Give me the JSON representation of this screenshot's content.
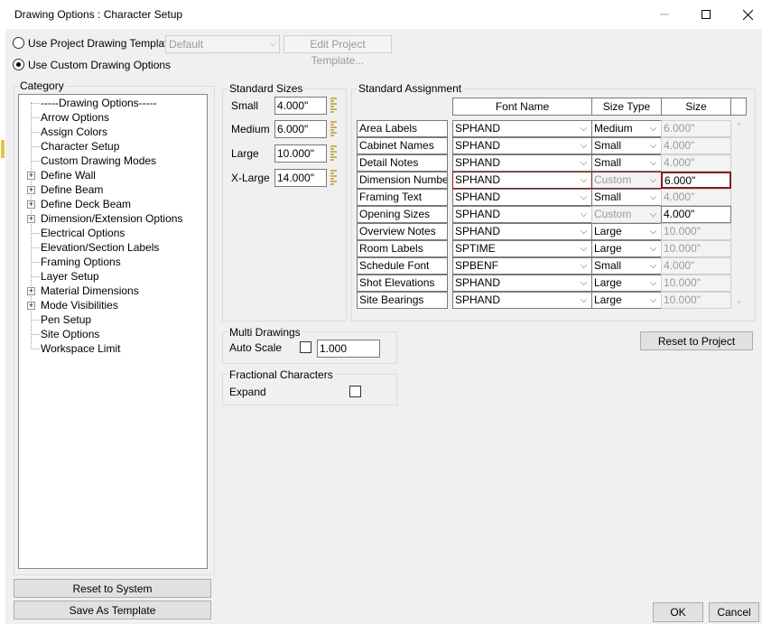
{
  "window": {
    "title": "Drawing Options : Character Setup"
  },
  "template_options": {
    "use_project": "Use Project Drawing Template",
    "use_custom": "Use Custom Drawing Options",
    "template_combo": "Default",
    "edit_template_btn": "Edit Project Template..."
  },
  "category": {
    "title": "Category",
    "items": [
      {
        "label": "-----Drawing Options-----",
        "expandable": false
      },
      {
        "label": "Arrow Options",
        "expandable": false
      },
      {
        "label": "Assign Colors",
        "expandable": false
      },
      {
        "label": "Character Setup",
        "expandable": false
      },
      {
        "label": "Custom Drawing Modes",
        "expandable": false
      },
      {
        "label": "Define Wall",
        "expandable": true
      },
      {
        "label": "Define Beam",
        "expandable": true
      },
      {
        "label": "Define Deck Beam",
        "expandable": true
      },
      {
        "label": "Dimension/Extension Options",
        "expandable": true
      },
      {
        "label": "Electrical Options",
        "expandable": false
      },
      {
        "label": "Elevation/Section Labels",
        "expandable": false
      },
      {
        "label": "Framing Options",
        "expandable": false
      },
      {
        "label": "Layer Setup",
        "expandable": false
      },
      {
        "label": "Material Dimensions",
        "expandable": true
      },
      {
        "label": "Mode Visibilities",
        "expandable": true
      },
      {
        "label": "Pen Setup",
        "expandable": false
      },
      {
        "label": "Site Options",
        "expandable": false
      },
      {
        "label": "Workspace Limit",
        "expandable": false
      }
    ]
  },
  "standard_sizes": {
    "title": "Standard Sizes",
    "rows": [
      {
        "label": "Small",
        "value": "4.000\""
      },
      {
        "label": "Medium",
        "value": "6.000\""
      },
      {
        "label": "Large",
        "value": "10.000\""
      },
      {
        "label": "X-Large",
        "value": "14.000\""
      }
    ]
  },
  "standard_assignment": {
    "title": "Standard Assignment",
    "headers": {
      "font": "Font Name",
      "size_type": "Size Type",
      "size": "Size"
    },
    "rows": [
      {
        "label": "Area Labels",
        "font": "SPHAND",
        "size_type": "Medium",
        "size": "6.000\"",
        "type_disabled": false,
        "size_enabled": false,
        "selected": false
      },
      {
        "label": "Cabinet Names",
        "font": "SPHAND",
        "size_type": "Small",
        "size": "4.000\"",
        "type_disabled": false,
        "size_enabled": false,
        "selected": false
      },
      {
        "label": "Detail Notes",
        "font": "SPHAND",
        "size_type": "Small",
        "size": "4.000\"",
        "type_disabled": false,
        "size_enabled": false,
        "selected": false
      },
      {
        "label": "Dimension Numbers",
        "font": "SPHAND",
        "size_type": "Custom",
        "size": "6.000\"",
        "type_disabled": true,
        "size_enabled": true,
        "selected": true
      },
      {
        "label": "Framing Text",
        "font": "SPHAND",
        "size_type": "Small",
        "size": "4.000\"",
        "type_disabled": false,
        "size_enabled": false,
        "selected": false
      },
      {
        "label": "Opening Sizes",
        "font": "SPHAND",
        "size_type": "Custom",
        "size": "4.000\"",
        "type_disabled": true,
        "size_enabled": true,
        "selected": false
      },
      {
        "label": "Overview Notes",
        "font": "SPHAND",
        "size_type": "Large",
        "size": "10.000\"",
        "type_disabled": false,
        "size_enabled": false,
        "selected": false
      },
      {
        "label": "Room Labels",
        "font": "SPTIME",
        "size_type": "Large",
        "size": "10.000\"",
        "type_disabled": false,
        "size_enabled": false,
        "selected": false
      },
      {
        "label": "Schedule Font",
        "font": "SPBENF",
        "size_type": "Small",
        "size": "4.000\"",
        "type_disabled": false,
        "size_enabled": false,
        "selected": false
      },
      {
        "label": "Shot Elevations",
        "font": "SPHAND",
        "size_type": "Large",
        "size": "10.000\"",
        "type_disabled": false,
        "size_enabled": false,
        "selected": false
      },
      {
        "label": "Site Bearings",
        "font": "SPHAND",
        "size_type": "Large",
        "size": "10.000\"",
        "type_disabled": false,
        "size_enabled": false,
        "selected": false
      }
    ]
  },
  "multi_drawings": {
    "title": "Multi Drawings",
    "auto_scale_label": "Auto Scale",
    "auto_scale_value": "1.000"
  },
  "fractional": {
    "title": "Fractional Characters",
    "expand_label": "Expand"
  },
  "buttons": {
    "reset_project": "Reset to Project",
    "reset_system": "Reset to System",
    "save_template": "Save As Template",
    "ok": "OK",
    "cancel": "Cancel"
  },
  "colors": {
    "selection_border": "#8b1a1a",
    "disabled_text": "#9a9a9a"
  }
}
